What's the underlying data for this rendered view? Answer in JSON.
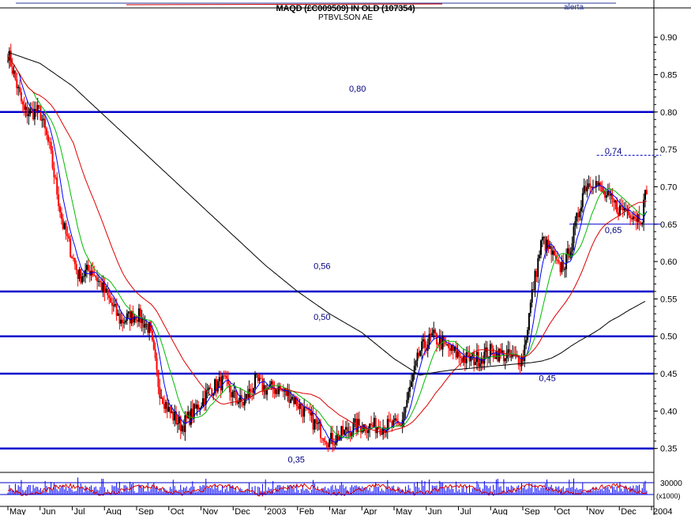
{
  "header": {
    "title": "MAQD (£C009509) IN OLD (107354)",
    "subtitle": "PTBVLSON AE",
    "alert": "alerta"
  },
  "colors": {
    "background": "#ffffff",
    "hline": "#0000cc",
    "annotation": "#000080",
    "candle_up": "#000000",
    "candle_down": "#ff0000",
    "ma_fast": "#0000ff",
    "ma_mid": "#00bb00",
    "ma_slow": "#dd0000",
    "ma_long": "#000000",
    "volume": "#0000ff",
    "oscillator": "#dd0000"
  },
  "chart_data": {
    "type": "line",
    "subtype": "candlestick",
    "title": "MAQD (£C009509) IN OLD (107354)",
    "subtitle": "PTBVLSON AE",
    "x_tick_labels": [
      "May",
      "Jun",
      "Jul",
      "Aug",
      "Sep",
      "Oct",
      "Nov",
      "Dec",
      "2003",
      "Feb",
      "Mar",
      "Apr",
      "May",
      "Jun",
      "Jul",
      "Aug",
      "Sep",
      "Oct",
      "Nov",
      "Dec",
      "2004"
    ],
    "y_tick_labels": [
      "0.90",
      "0.85",
      "0.80",
      "0.75",
      "0.70",
      "0.65",
      "0.60",
      "0.55",
      "0.50",
      "0.45",
      "0.40",
      "0.35"
    ],
    "ylim": [
      0.318,
      0.935
    ],
    "grid": false,
    "horizontal_lines": [
      0.8,
      0.56,
      0.5,
      0.45,
      0.35
    ],
    "annotations": [
      {
        "text": "0,80",
        "x": 10.6,
        "y": 0.827
      },
      {
        "text": "0,74",
        "x": 18.55,
        "y": 0.744
      },
      {
        "text": "0,65",
        "x": 18.55,
        "y": 0.638
      },
      {
        "text": "0,56",
        "x": 9.5,
        "y": 0.59
      },
      {
        "text": "0,50",
        "x": 9.5,
        "y": 0.522
      },
      {
        "text": "0,45",
        "x": 16.5,
        "y": 0.44
      },
      {
        "text": "0,35",
        "x": 8.7,
        "y": 0.331
      }
    ],
    "segments": [
      {
        "x1": 17.45,
        "y1": 0.65,
        "x2": 20.3,
        "y2": 0.65,
        "style": "solid"
      },
      {
        "x1": 18.3,
        "y1": 0.742,
        "x2": 20.3,
        "y2": 0.742,
        "style": "dashed"
      }
    ],
    "price_anchors": {
      "x": [
        0,
        0.5,
        1.0,
        1.3,
        1.7,
        2.2,
        2.6,
        3.0,
        3.5,
        4.0,
        4.4,
        4.7,
        5.0,
        5.4,
        5.8,
        6.3,
        6.7,
        7.0,
        7.3,
        7.7,
        8.0,
        8.4,
        8.8,
        9.2,
        9.6,
        10.0,
        10.4,
        10.8,
        11.2,
        11.7,
        12.2,
        12.5,
        12.8,
        13.2,
        13.5,
        13.8,
        14.2,
        14.6,
        15.0,
        15.4,
        15.7,
        16.0,
        16.3,
        16.6,
        16.9,
        17.1,
        17.35,
        17.6,
        17.9,
        18.2,
        18.5,
        18.75,
        19.0,
        19.3,
        19.5,
        19.7,
        19.85
      ],
      "y": [
        0.88,
        0.8,
        0.8,
        0.75,
        0.65,
        0.58,
        0.59,
        0.56,
        0.52,
        0.53,
        0.51,
        0.43,
        0.4,
        0.38,
        0.4,
        0.43,
        0.44,
        0.42,
        0.41,
        0.44,
        0.43,
        0.43,
        0.42,
        0.4,
        0.38,
        0.36,
        0.37,
        0.38,
        0.38,
        0.38,
        0.38,
        0.43,
        0.48,
        0.5,
        0.49,
        0.48,
        0.47,
        0.47,
        0.48,
        0.475,
        0.47,
        0.47,
        0.56,
        0.63,
        0.61,
        0.59,
        0.6,
        0.64,
        0.7,
        0.71,
        0.69,
        0.68,
        0.67,
        0.67,
        0.66,
        0.66,
        0.7
      ]
    },
    "candle_count": 430,
    "moving_averages": [
      {
        "window_bars": 8,
        "color_key": "ma_fast"
      },
      {
        "window_bars": 18,
        "color_key": "ma_mid"
      },
      {
        "window_bars": 45,
        "color_key": "ma_slow"
      },
      {
        "window_bars": 200,
        "color_key": "ma_long"
      }
    ],
    "long_ma_tail": {
      "x": [
        12.8,
        13.3,
        13.8,
        14.3,
        14.8,
        15.3,
        15.8,
        16.3,
        16.6,
        16.9,
        17.2,
        17.5,
        17.8,
        18.1,
        18.4,
        18.7,
        19.0,
        19.3,
        19.6,
        19.85
      ],
      "y": [
        0.448,
        0.452,
        0.455,
        0.457,
        0.459,
        0.461,
        0.463,
        0.465,
        0.467,
        0.471,
        0.478,
        0.487,
        0.495,
        0.502,
        0.51,
        0.52,
        0.527,
        0.535,
        0.542,
        0.548
      ]
    },
    "volume_panel": {
      "y_tick_labels": [
        "30000",
        "(x1000)"
      ],
      "ylim": [
        0,
        35000
      ]
    }
  }
}
